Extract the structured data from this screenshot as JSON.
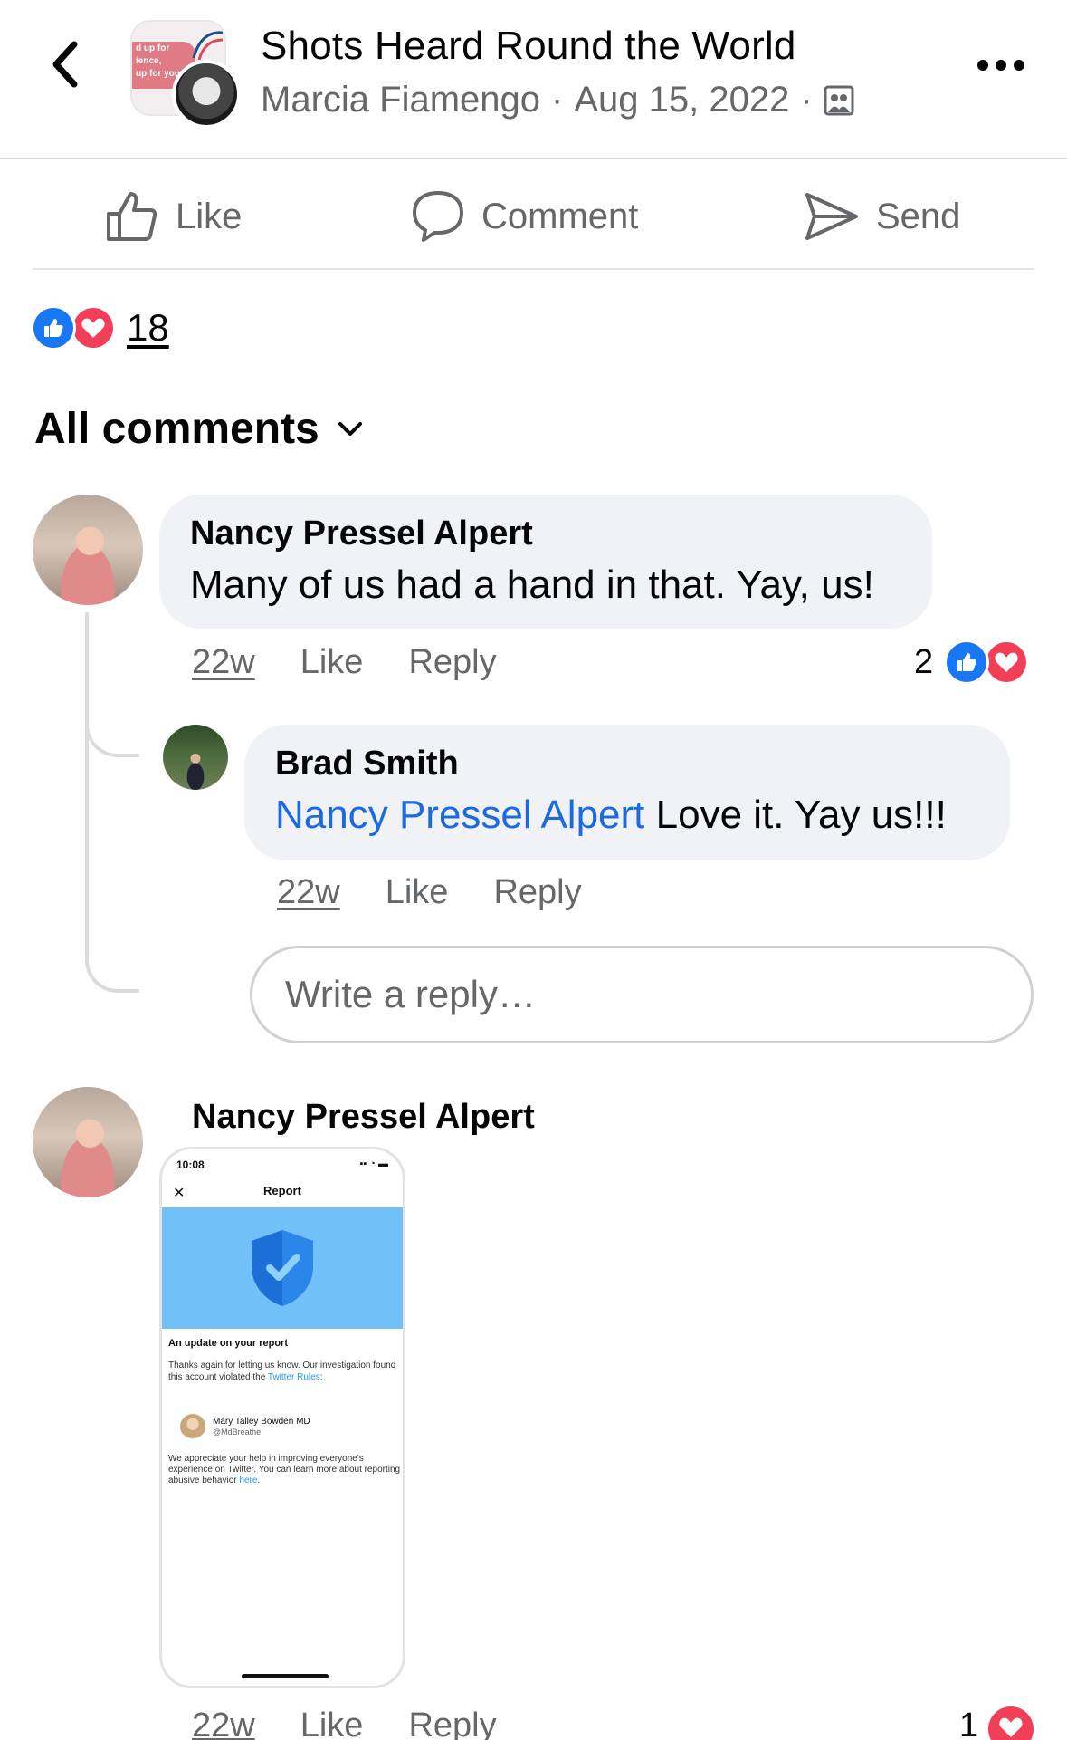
{
  "post": {
    "title": "Shots Heard Round the World",
    "author": "Marcia Fiamengo",
    "separator1": "·",
    "date": "Aug 15, 2022",
    "separator2": "·",
    "audience_icon": "group-audience-icon",
    "group_thumb_lines": [
      "d up for",
      "ience,",
      "up for you"
    ]
  },
  "actions": {
    "like": "Like",
    "comment": "Comment",
    "send": "Send"
  },
  "reactions": {
    "count": "18",
    "types": [
      "like",
      "love"
    ]
  },
  "comments_filter": {
    "label": "All comments"
  },
  "comments": [
    {
      "author": "Nancy Pressel Alpert",
      "text": "Many of us had a hand in that. Yay, us!",
      "time": "22w",
      "like": "Like",
      "reply": "Reply",
      "reaction_count": "2",
      "replies": [
        {
          "author": "Brad Smith",
          "mention": "Nancy Pressel Alpert",
          "text": " Love it. Yay us!!!",
          "time": "22w",
          "like": "Like",
          "reply": "Reply"
        }
      ],
      "reply_placeholder": "Write a reply…"
    },
    {
      "author": "Nancy Pressel Alpert",
      "attachment": {
        "status_time": "10:08",
        "status_icons": "▪▪ ◔ ▬",
        "close": "✕",
        "title": "Report",
        "heading": "An update on your report",
        "body_text": "Thanks again for letting us know. Our investigation found this account violated the ",
        "body_link": "Twitter Rules",
        "body_end": ":",
        "reported_name": "Mary Talley Bowden MD",
        "reported_handle": "@MdBreathe",
        "footer_text": "We appreciate your help in improving everyone's experience on Twitter. You can learn more about reporting abusive behavior ",
        "footer_link": "here",
        "footer_end": "."
      },
      "time": "22w",
      "like": "Like",
      "reply": "Reply",
      "reaction_count": "1"
    }
  ],
  "colors": {
    "like_blue": "#1877f2",
    "love_red": "#f33e58",
    "mention_blue": "#1d6ae0",
    "bubble_gray": "#f0f2f5",
    "secondary_text": "#65676b",
    "twitter_blue": "#1d9bf0",
    "banner_blue": "#71c0f7"
  }
}
